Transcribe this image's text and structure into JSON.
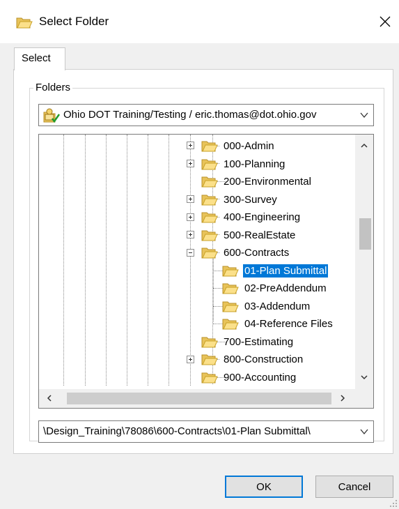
{
  "window": {
    "title": "Select Folder",
    "close_icon": "close-icon"
  },
  "tabs": [
    {
      "label": "Select"
    }
  ],
  "folders_group": {
    "label": "Folders"
  },
  "datasource": {
    "value": "Ohio DOT Training/Testing / eric.thomas@dot.ohio.gov"
  },
  "tree": {
    "nodes": [
      {
        "label": "000-Admin",
        "expander": "plus"
      },
      {
        "label": "100-Planning",
        "expander": "plus"
      },
      {
        "label": "200-Environmental",
        "expander": "none"
      },
      {
        "label": "300-Survey",
        "expander": "plus"
      },
      {
        "label": "400-Engineering",
        "expander": "plus"
      },
      {
        "label": "500-RealEstate",
        "expander": "plus"
      },
      {
        "label": "600-Contracts",
        "expander": "minus"
      },
      {
        "label": "01-Plan Submittal",
        "expander": "none",
        "selected": true
      },
      {
        "label": "02-PreAddendum",
        "expander": "none"
      },
      {
        "label": "03-Addendum",
        "expander": "none"
      },
      {
        "label": "04-Reference Files",
        "expander": "none"
      },
      {
        "label": "700-Estimating",
        "expander": "none"
      },
      {
        "label": "800-Construction",
        "expander": "plus"
      },
      {
        "label": "900-Accounting",
        "expander": "none"
      }
    ]
  },
  "path": {
    "value": "\\Design_Training\\78086\\600-Contracts\\01-Plan Submittal\\"
  },
  "buttons": {
    "ok": "OK",
    "cancel": "Cancel"
  },
  "colors": {
    "selection": "#0078d7",
    "folder_fill": "#f8d775",
    "folder_stroke": "#c9a227"
  }
}
